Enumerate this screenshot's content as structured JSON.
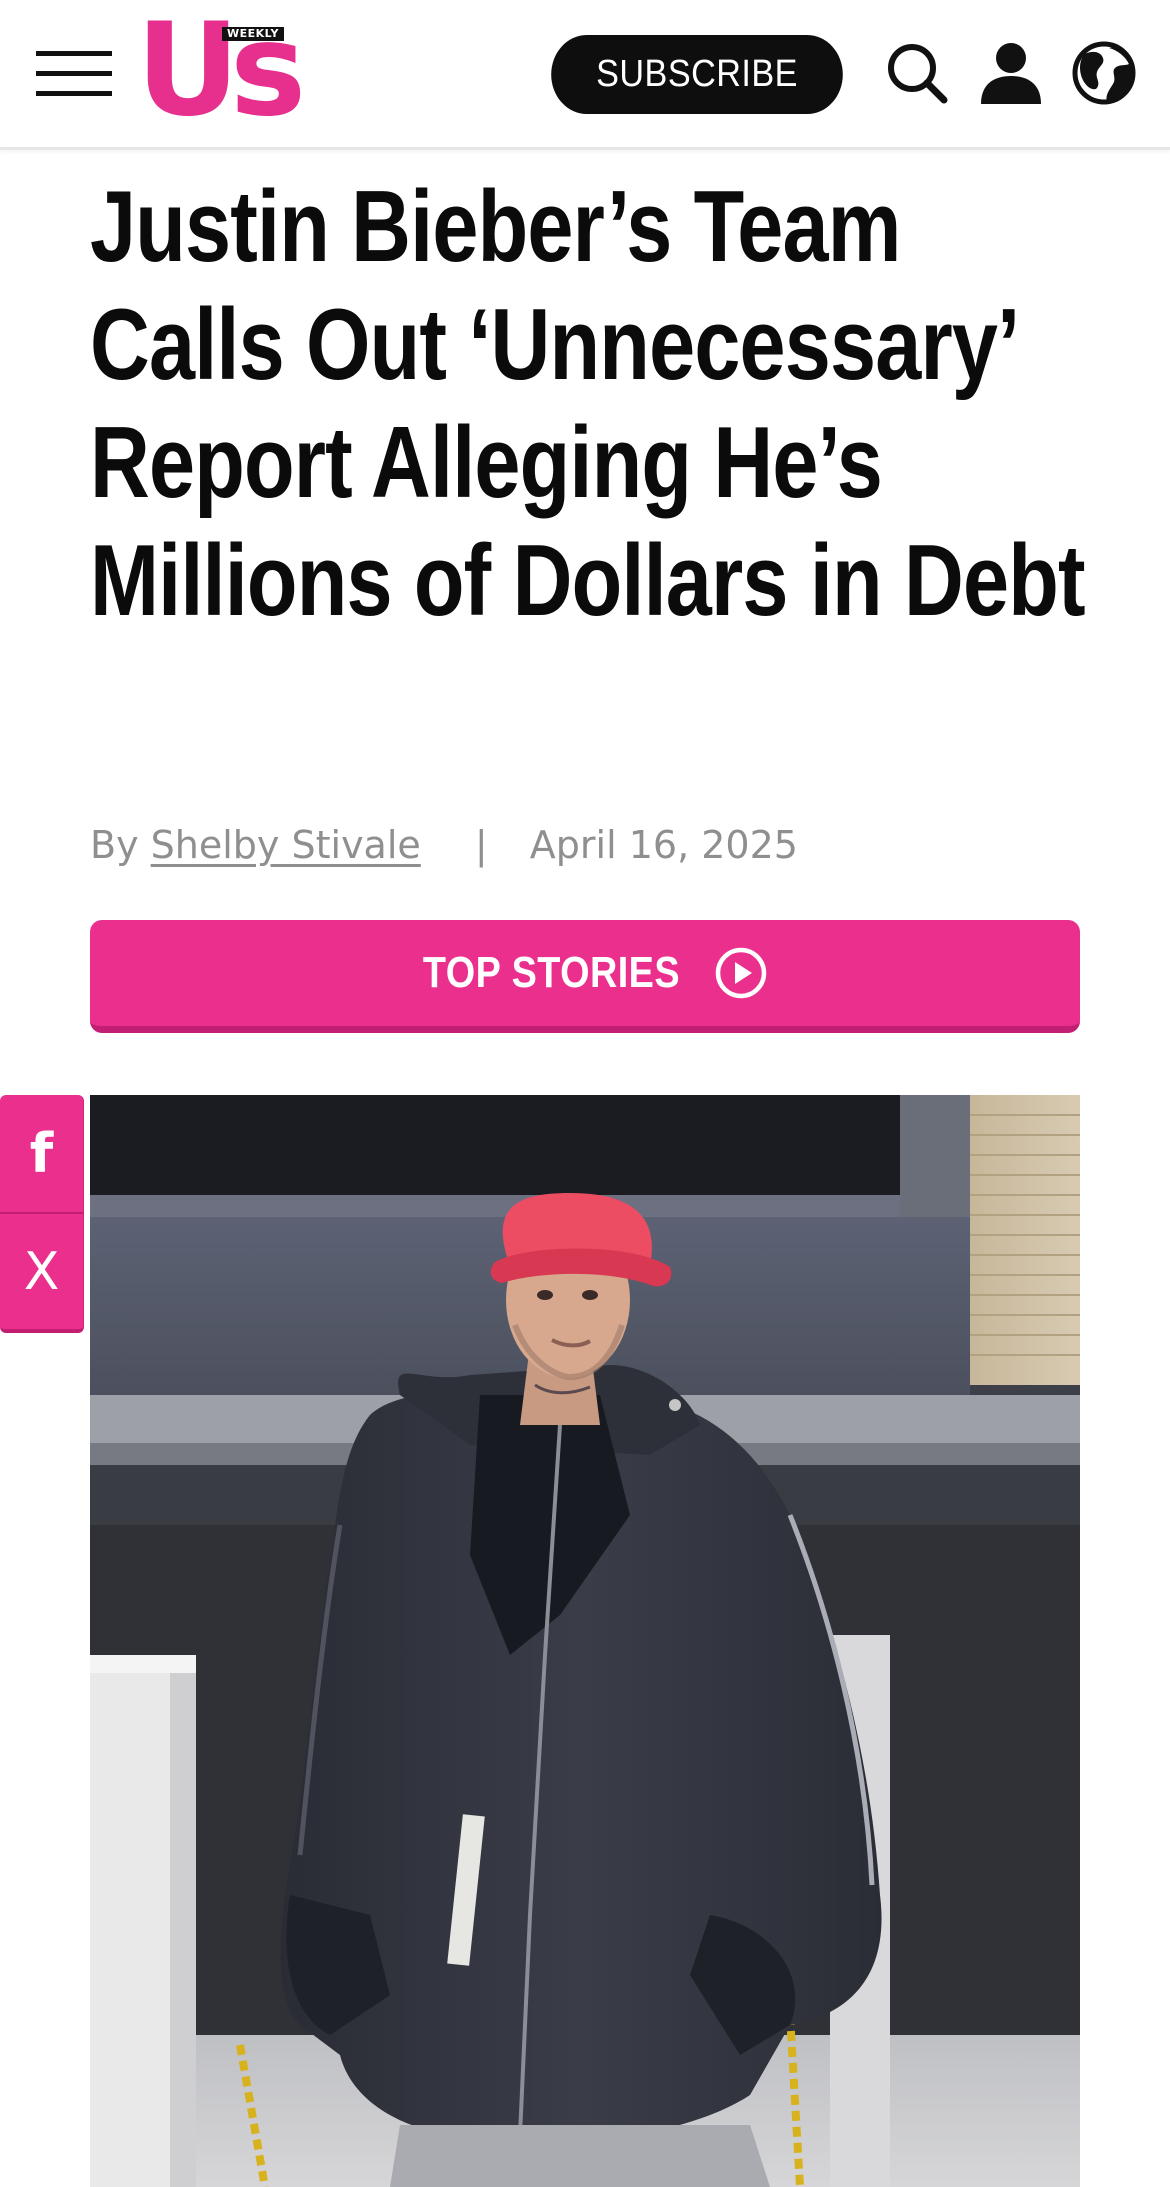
{
  "header": {
    "logo_text": "Us",
    "logo_tag": "WEEKLY",
    "subscribe_label": "SUBSCRIBE",
    "icons": [
      "menu-icon",
      "search-icon",
      "user-icon",
      "globe-icon"
    ]
  },
  "article": {
    "headline": "Justin Bieber’s Team Calls Out ‘Unnecessary’ Report Alleging He’s Millions of Dollars in Debt",
    "byline_prefix": "By",
    "author": "Shelby Stivale",
    "separator": "|",
    "date": "April 16, 2025"
  },
  "top_stories": {
    "label": "TOP STORIES",
    "icon": "play-circle-icon"
  },
  "share": {
    "facebook_glyph": "f",
    "x_glyph": "X"
  },
  "colors": {
    "brand_pink": "#ea2f8d",
    "header_black": "#0e0e0e",
    "byline_gray": "#8f8f8f"
  }
}
